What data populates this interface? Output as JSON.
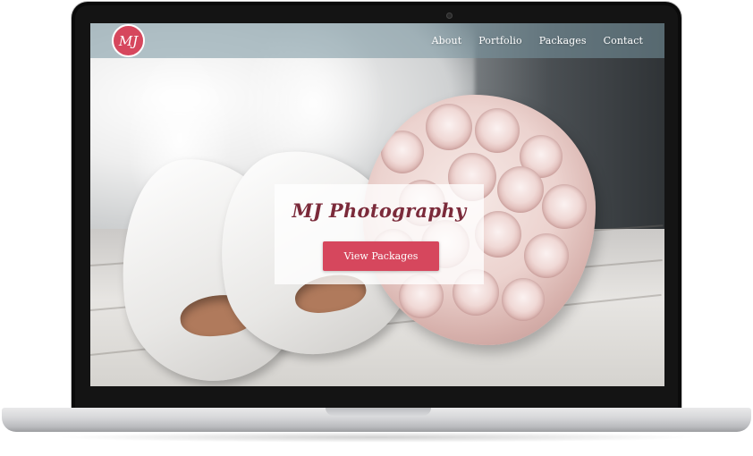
{
  "site": {
    "logo_text": "MJ",
    "nav": {
      "items": [
        {
          "label": "About"
        },
        {
          "label": "Portfolio"
        },
        {
          "label": "Packages"
        },
        {
          "label": "Contact"
        }
      ]
    },
    "hero": {
      "title": "MJ Photography",
      "button_label": "View Packages"
    }
  },
  "colors": {
    "accent": "#d6475d",
    "title": "#7b2a3a"
  }
}
